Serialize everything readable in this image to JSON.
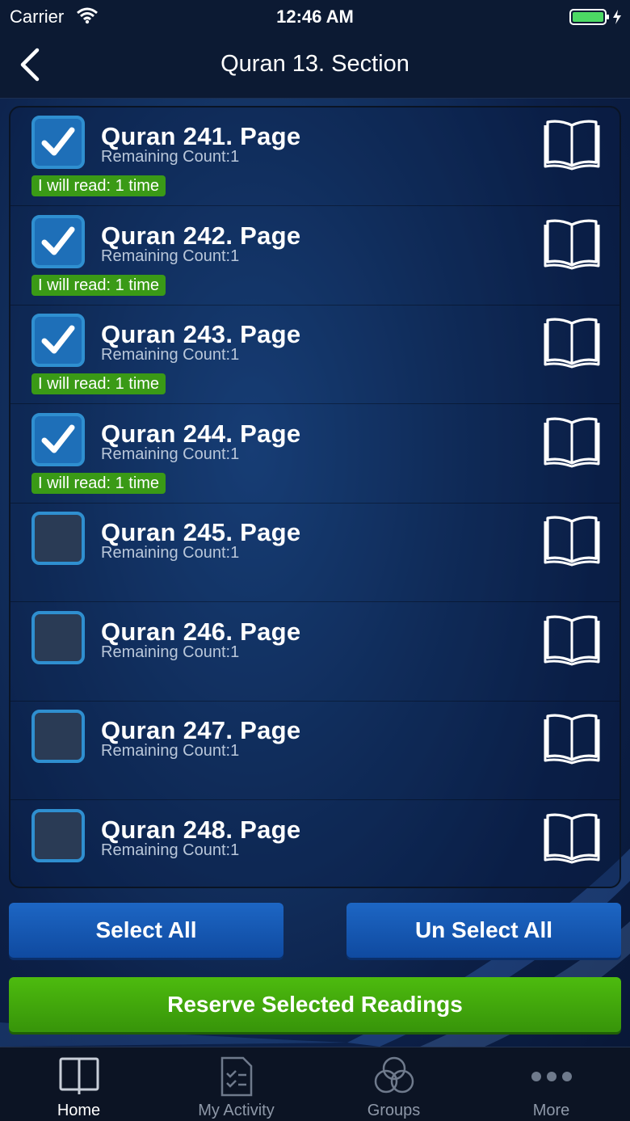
{
  "status": {
    "carrier": "Carrier",
    "time": "12:46 AM"
  },
  "nav": {
    "title": "Quran 13. Section"
  },
  "items": [
    {
      "name": "Quran 241. Page",
      "remaining": "Remaining Count:1",
      "tag": "I will read: 1 time",
      "checked": true
    },
    {
      "name": "Quran 242. Page",
      "remaining": "Remaining Count:1",
      "tag": "I will read: 1 time",
      "checked": true
    },
    {
      "name": "Quran 243. Page",
      "remaining": "Remaining Count:1",
      "tag": "I will read: 1 time",
      "checked": true
    },
    {
      "name": "Quran 244. Page",
      "remaining": "Remaining Count:1",
      "tag": "I will read: 1 time",
      "checked": true
    },
    {
      "name": "Quran 245. Page",
      "remaining": "Remaining Count:1",
      "tag": "",
      "checked": false
    },
    {
      "name": "Quran 246. Page",
      "remaining": "Remaining Count:1",
      "tag": "",
      "checked": false
    },
    {
      "name": "Quran 247. Page",
      "remaining": "Remaining Count:1",
      "tag": "",
      "checked": false
    },
    {
      "name": "Quran 248. Page",
      "remaining": "Remaining Count:1",
      "tag": "",
      "checked": false
    }
  ],
  "buttons": {
    "select_all": "Select All",
    "unselect_all": "Un Select All",
    "reserve": "Reserve Selected Readings"
  },
  "tabs": [
    {
      "label": "Home",
      "icon": "book-icon",
      "active": true
    },
    {
      "label": "My Activity",
      "icon": "checklist-icon",
      "active": false
    },
    {
      "label": "Groups",
      "icon": "groups-icon",
      "active": false
    },
    {
      "label": "More",
      "icon": "more-dots-icon",
      "active": false
    }
  ],
  "colors": {
    "accent_blue": "#1d66c4",
    "accent_green": "#4dbb0e",
    "tag_green": "#3a9a16",
    "checkbox_border": "#2f8fd0"
  }
}
